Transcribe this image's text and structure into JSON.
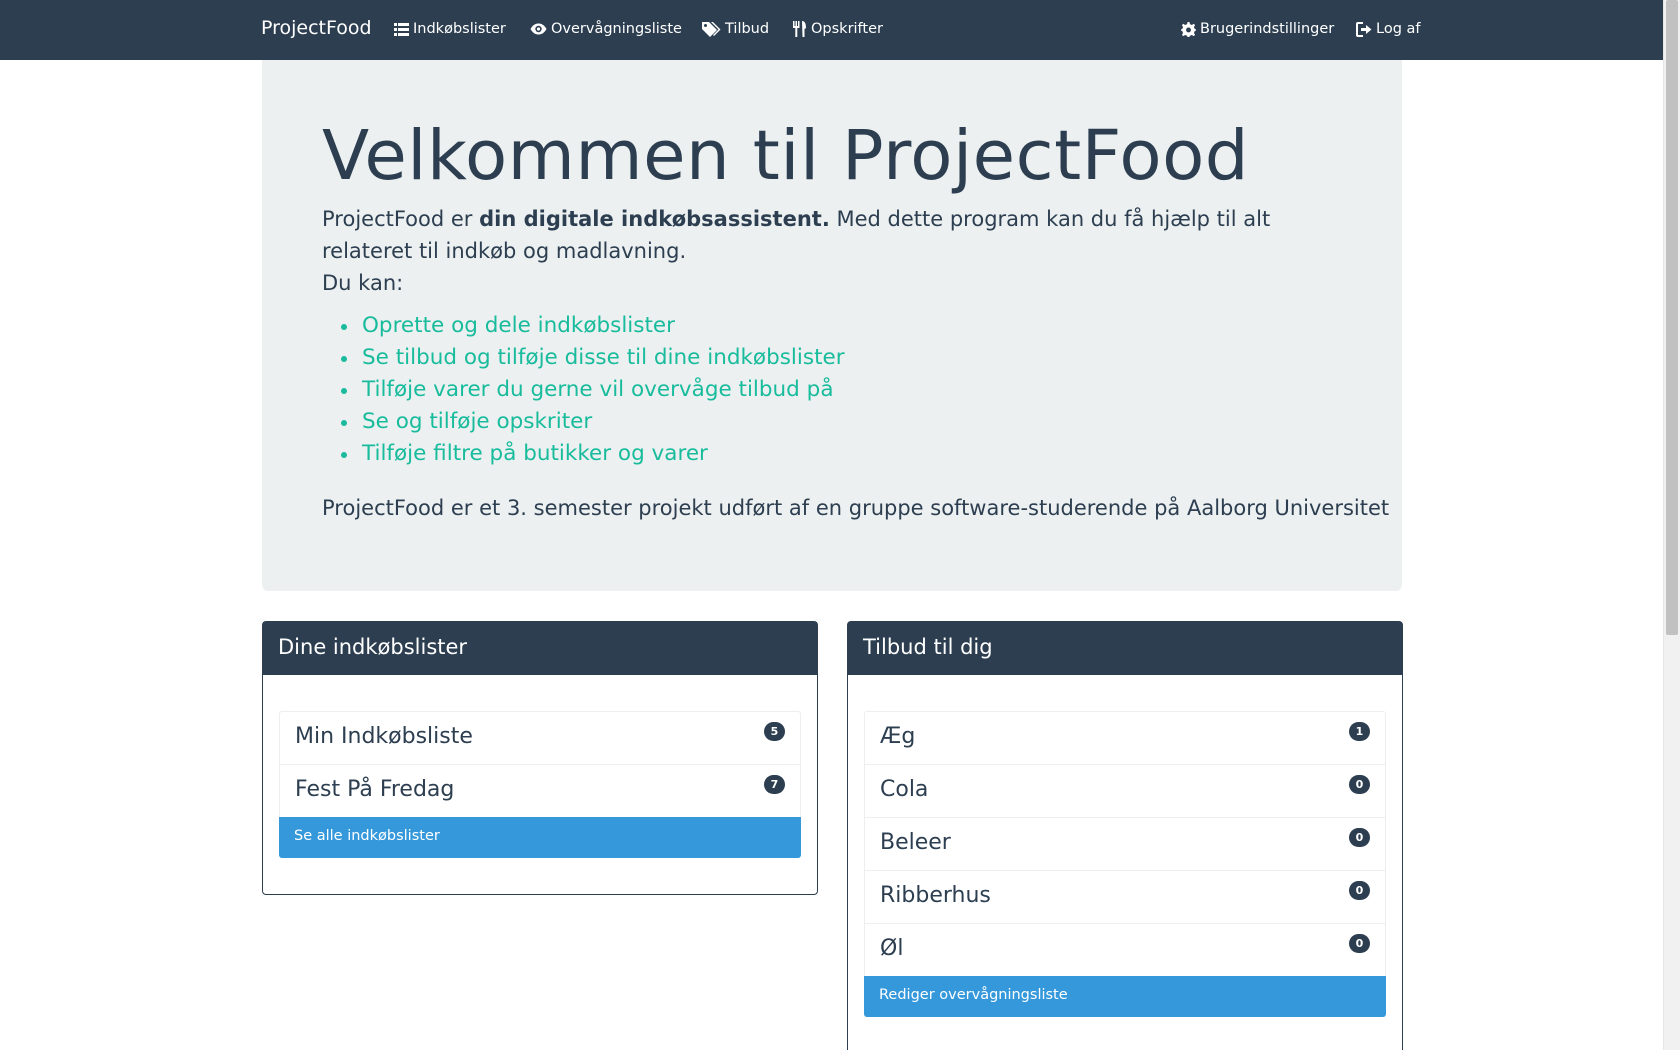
{
  "navbar": {
    "brand": "ProjectFood",
    "links": [
      {
        "label": "Indkøbslister",
        "icon": "list-icon"
      },
      {
        "label": "Overvågningsliste",
        "icon": "eye-icon"
      },
      {
        "label": "Tilbud",
        "icon": "tags-icon"
      },
      {
        "label": "Opskrifter",
        "icon": "cutlery-icon"
      }
    ],
    "right_links": [
      {
        "label": "Brugerindstillinger",
        "icon": "gear-icon"
      },
      {
        "label": "Log af",
        "icon": "logout-icon"
      }
    ]
  },
  "jumbotron": {
    "title": "Velkommen til ProjectFood",
    "intro_prefix": "ProjectFood er ",
    "intro_bold": "din digitale indkøbsassistent.",
    "intro_suffix": " Med dette program kan du få hjælp til alt relateret til indkøb og madlavning.",
    "you_can": "Du kan:",
    "features": [
      "Oprette og dele indkøbslister",
      "Se tilbud og tilføje disse til dine indkøbslister",
      "Tilføje varer du gerne vil overvåge tilbud på",
      "Se og tilføje opskriter",
      "Tilføje filtre på butikker og varer"
    ],
    "footer": "ProjectFood er et 3. semester projekt udført af en gruppe software-studerende på Aalborg Universitet"
  },
  "shopping_panel": {
    "title": "Dine indkøbslister",
    "items": [
      {
        "name": "Min Indkøbsliste",
        "count": "5"
      },
      {
        "name": "Fest På Fredag",
        "count": "7"
      }
    ],
    "action_label": "Se alle indkøbslister"
  },
  "offers_panel": {
    "title": "Tilbud til dig",
    "items": [
      {
        "name": "Æg",
        "count": "1"
      },
      {
        "name": "Cola",
        "count": "0"
      },
      {
        "name": "Beleer",
        "count": "0"
      },
      {
        "name": "Ribberhus",
        "count": "0"
      },
      {
        "name": "Øl",
        "count": "0"
      }
    ],
    "action_label": "Rediger overvågningsliste"
  },
  "colors": {
    "primary": "#2c3e50",
    "success": "#18bc9c",
    "info": "#3498db",
    "jumbotron_bg": "#ecf0f1"
  }
}
